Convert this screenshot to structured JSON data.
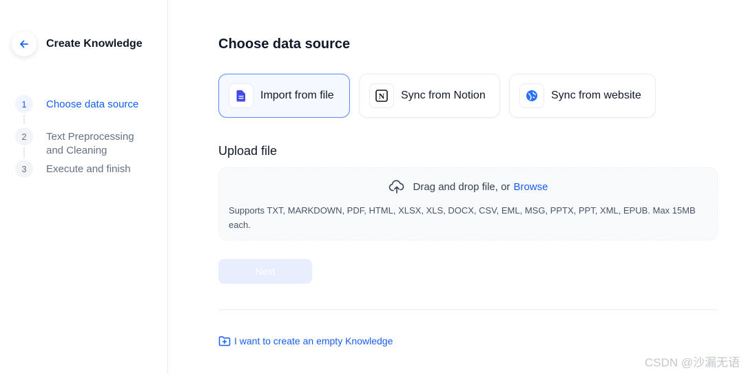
{
  "header": {
    "title": "Create Knowledge"
  },
  "steps": [
    {
      "num": "1",
      "label": "Choose data source"
    },
    {
      "num": "2",
      "label_line1": "Text Preprocessing",
      "label_line2": "and Cleaning"
    },
    {
      "num": "3",
      "label": "Execute and finish"
    }
  ],
  "main": {
    "title": "Choose data source",
    "sources": [
      {
        "label": "Import from file",
        "icon": "file-icon",
        "selected": true
      },
      {
        "label": "Sync from Notion",
        "icon": "notion-icon",
        "selected": false
      },
      {
        "label": "Sync from website",
        "icon": "globe-icon",
        "selected": false
      }
    ],
    "upload": {
      "title": "Upload file",
      "drag_text": "Drag and drop file, or",
      "browse_label": "Browse",
      "hint": "Supports TXT, MARKDOWN, PDF, HTML, XLSX, XLS, DOCX, CSV, EML, MSG, PPTX, PPT, XML, EPUB. Max 15MB each."
    },
    "next_label": "Next",
    "empty_link": "I want to create an empty Knowledge"
  },
  "watermark": "CSDN @沙漏无语",
  "colors": {
    "accent": "#155eef",
    "disabled_button": "#e9eefe",
    "selected_card_border": "#528bff"
  }
}
